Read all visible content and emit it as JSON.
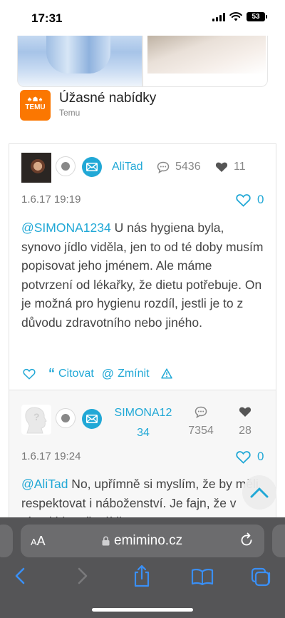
{
  "status_bar": {
    "time": "17:31",
    "battery": "53"
  },
  "ad": {
    "logo_text": "TEMU",
    "title": "Úžasné nabídky",
    "source": "Temu"
  },
  "posts": [
    {
      "username": "AliTad",
      "comments": "5436",
      "likes_received": "11",
      "date": "1.6.17 19:19",
      "like_count": "0",
      "mention": "@SIMONA1234",
      "text": " U nás hygiena byla, synovo jídlo viděla, jen to od té doby musím popisovat jeho jménem. Ale máme potvrzení od lékařky, že dietu potřebuje. On je možná pro hygienu rozdíl, jestli je to z důvodu zdravotního nebo jiného.",
      "actions": {
        "quote": "Citovat",
        "mention": "Zmínit"
      }
    },
    {
      "username": "SIMONA12",
      "username_line2": "34",
      "comments": "7354",
      "likes_received": "28",
      "date": "1.6.17 19:24",
      "like_count": "0",
      "mention": "@AliTad",
      "text": " No, upřímně si myslím, že by měli respektovat i náboženství. Je fajn, že v rámci hlavního jídla"
    }
  ],
  "browser": {
    "text_size_label": "AA",
    "url": "emimino.cz"
  },
  "colors": {
    "accent": "#21a8d6",
    "temu_orange": "#fb7701",
    "browser_bar": "#555557"
  }
}
